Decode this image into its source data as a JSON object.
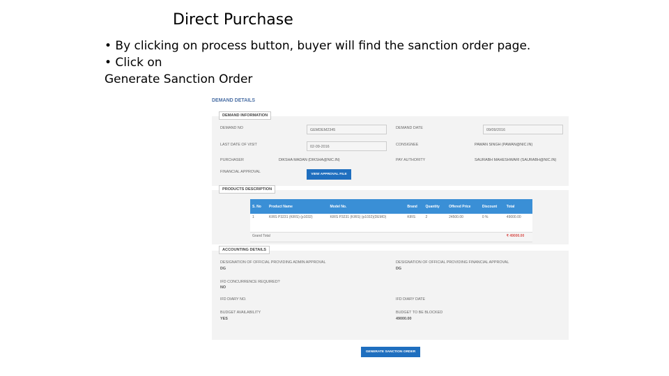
{
  "slide": {
    "title": "Direct Purchase",
    "bullet1": "• By clicking on process button, buyer will find the sanction order page.",
    "bullet2_line1": "• Click on",
    "bullet2_line2": "Generate Sanction Order"
  },
  "screenshot": {
    "header": "DEMAND DETAILS",
    "demand_info": {
      "section_label": "DEMAND INFORMATION",
      "demand_no_label": "DEMAND NO",
      "demand_no_value": "GEMDEM2345",
      "demand_date_label": "DEMAND DATE",
      "demand_date_value": "09/09/2016",
      "last_date_label": "LAST DATE OF VISIT",
      "last_date_value": "02-09-2016",
      "consignee_label": "CONSIGNEE",
      "consignee_value": "PAWAN SINGH (PAWAN@NIC.IN)",
      "purchaser_label": "PURCHASER",
      "purchaser_value": "DIKSHA MADAN (DIKSHA@NIC.IN)",
      "pay_authority_label": "PAY AUTHORITY",
      "pay_authority_value": "SAURABH MAHESHWARI (SAURABH@NIC.IN)",
      "financial_approval_label": "FINANCIAL APPROVAL",
      "financial_approval_button": "VIEW APPROVAL FILE"
    },
    "products": {
      "section_label": "PRODUCTS DESCRIPTION",
      "columns": [
        "S. No",
        "Product Name",
        "Model No.",
        "Brand",
        "Quantity",
        "Offered Price",
        "Discount",
        "Total"
      ],
      "rows": [
        [
          "1",
          "KIRS P3231 (KIRS) (p1032)",
          "KIRS P3231 (KIRS) (p1032)(DEMO)",
          "KIRS",
          "2",
          "24500.00",
          "0 %",
          "49000.00"
        ]
      ],
      "grand_total_label": "Grand Total",
      "grand_total_value": "₹ 49000.00"
    },
    "accounting": {
      "section_label": "ACCOUNTING DETAILS",
      "admin_approval_label": "DESIGNATION OF OFFICIAL PROVIDING ADMIN APPROVAL",
      "admin_approval_value": "DG",
      "fin_approval_label": "DESIGNATION OF OFFICIAL PROVIDING FINANCIAL APPROVAL",
      "fin_approval_value": "DG",
      "ifd_required_label": "IFD CONCURRENCE REQUIRED?",
      "ifd_required_value": "NO",
      "ifd_diary_no_label": "IFD DIARY NO.",
      "ifd_diary_date_label": "IFD DIARY DATE",
      "budget_label": "BUDGET AVAILABILITY",
      "budget_value": "YES",
      "budget_booked_label": "BUDGET TO BE BLOCKED",
      "budget_booked_value": "49000.00"
    },
    "generate_button": "GENERATE SANCTION ORDER"
  },
  "colors": {
    "accent": "#1f6fbf",
    "table_header": "#3a8fd6",
    "total_red": "#d9534f"
  }
}
